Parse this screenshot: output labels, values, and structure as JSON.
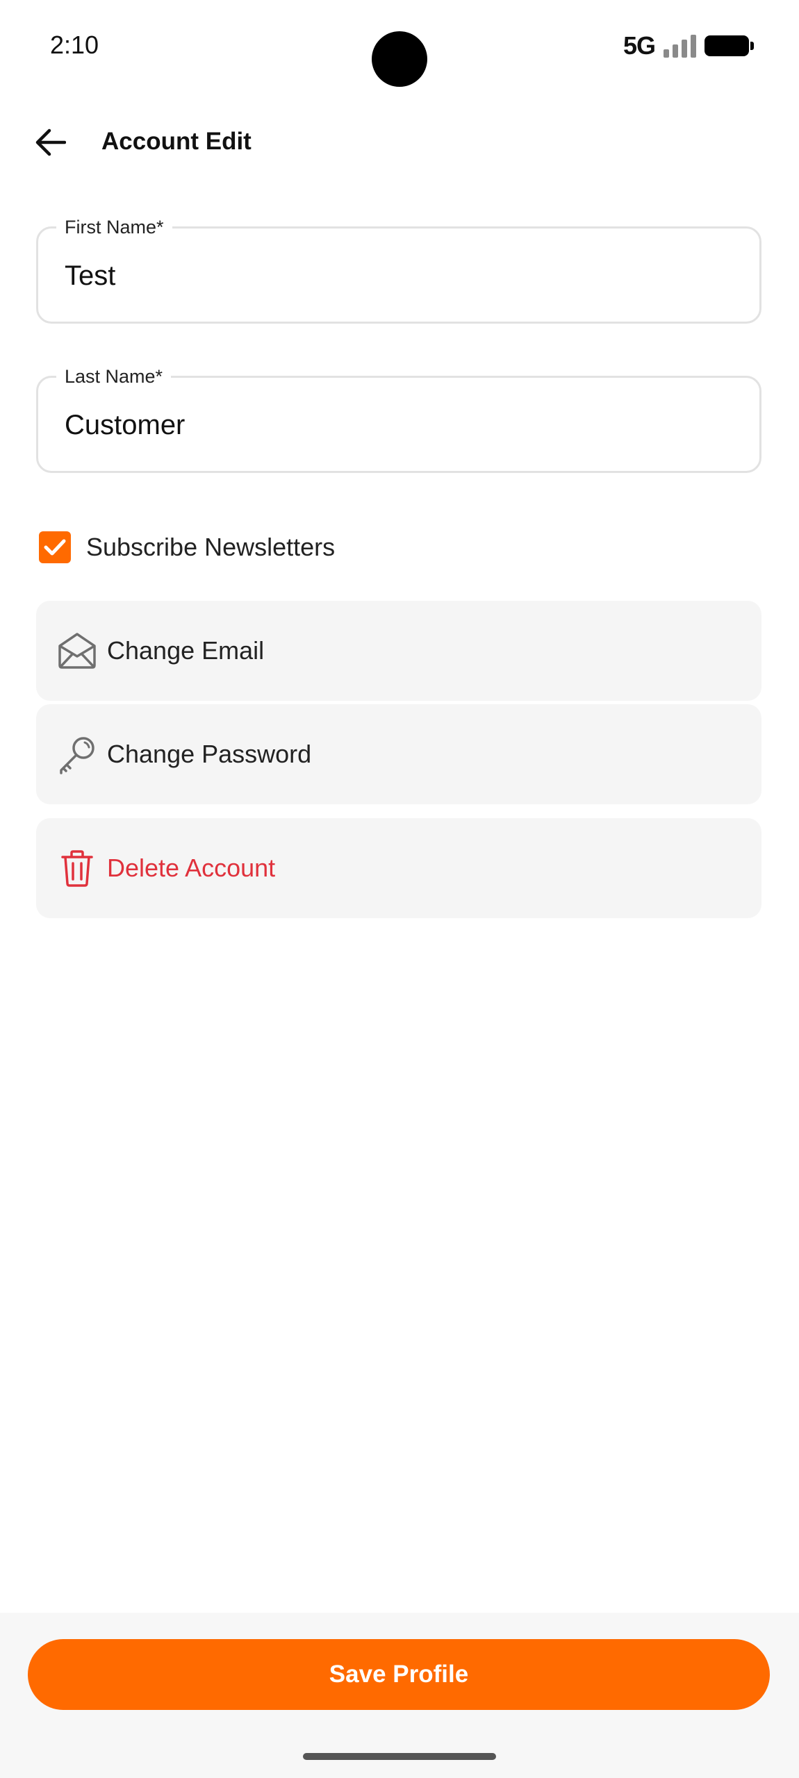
{
  "status_bar": {
    "time": "2:10",
    "network": "5G",
    "icons": [
      "camera-cutout",
      "signal-icon",
      "battery-icon"
    ]
  },
  "header": {
    "title": "Account Edit",
    "back_icon": "arrow-left-icon"
  },
  "form": {
    "first_name": {
      "label": "First Name*",
      "value": "Test"
    },
    "last_name": {
      "label": "Last Name*",
      "value": "Customer"
    },
    "newsletter": {
      "label": "Subscribe Newsletters",
      "checked": true
    }
  },
  "actions": [
    {
      "label": "Change Email",
      "icon": "envelope-open-icon"
    },
    {
      "label": "Change Password",
      "icon": "key-icon"
    },
    {
      "label": "Delete Account",
      "icon": "trash-icon"
    }
  ],
  "footer": {
    "save_label": "Save Profile"
  },
  "colors": {
    "accent": "#ff6a00",
    "danger": "#e0313c",
    "row_background": "#f5f5f5",
    "field_border": "#e2e2e2",
    "icon_gray": "#6f6f6f"
  }
}
